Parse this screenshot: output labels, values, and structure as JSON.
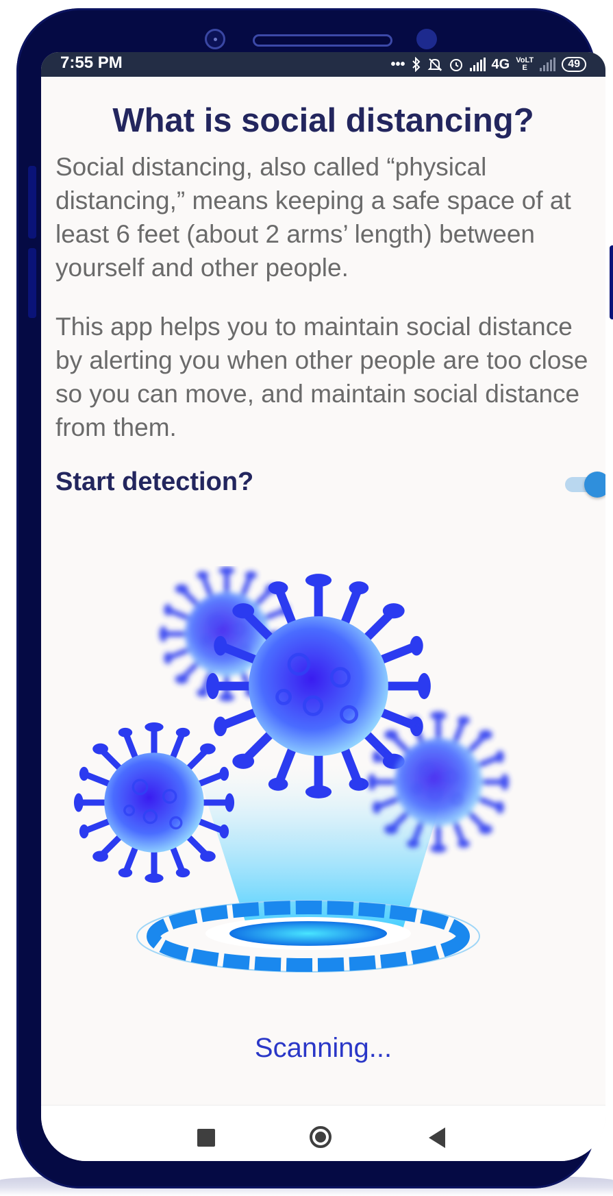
{
  "status_bar": {
    "time": "7:55 PM",
    "dots": "•••",
    "network": "4G",
    "volte": "VoLTE",
    "battery": "49"
  },
  "content": {
    "title": "What is social distancing?",
    "paragraph_1": "Social distancing, also called “physical distancing,” means keeping a safe space of at least 6 feet (about 2 arms’ length) between yourself and other people.",
    "paragraph_2": "This app helps you to maintain social distance by alerting you when other people are too close so you can move, and maintain social distance from them.",
    "detect_label": "Start detection?",
    "detect_enabled": true,
    "scan_status": "Scanning..."
  },
  "colors": {
    "accent": "#2f8fdc",
    "title": "#23265e",
    "body_text": "#6a6a6a",
    "scan_text": "#2a37c7",
    "phone_frame": "#050a44",
    "status_bar": "#232d45"
  },
  "icons": [
    "bluetooth-icon",
    "mute-icon",
    "alarm-icon",
    "signal-icon",
    "battery-icon",
    "virus-illustration",
    "hologram-scanner",
    "recents-icon",
    "home-icon",
    "back-icon"
  ]
}
